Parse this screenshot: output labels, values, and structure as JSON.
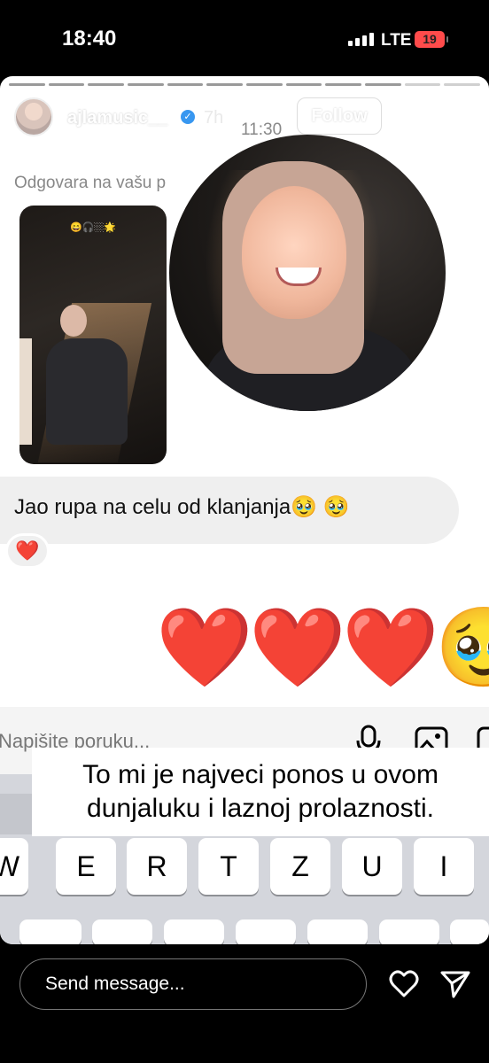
{
  "status_bar": {
    "time": "18:40",
    "network": "LTE",
    "battery": "19",
    "battery_color": "#ff4b4b"
  },
  "story": {
    "username": "ajlamusic__",
    "age": "7h",
    "follow_label": "Follow",
    "more_label": "•••",
    "close_icon": "close-icon",
    "progress_segments": 12,
    "progress_done": 10
  },
  "chat": {
    "timestamp": "11:30",
    "reply_note": "Odgovara na vašu p",
    "story_thumb_emojis": "😄🎧🏼🌟",
    "message": "Jao rupa na celu od klanjanja🥹 🥹",
    "reaction": "❤️",
    "big_emojis": [
      "❤️",
      "❤️",
      "❤️",
      "🥹"
    ]
  },
  "composer": {
    "placeholder": "Napišite poruku..."
  },
  "caption": {
    "line1": "To mi je najveci ponos u ovom",
    "line2": "dunjaluku i laznoj prolaznosti."
  },
  "keyboard": {
    "row1": [
      "W",
      "E",
      "R",
      "T",
      "Z",
      "U",
      "I"
    ]
  },
  "reply_bar": {
    "placeholder": "Send message...",
    "like_icon": "heart-icon",
    "share_icon": "send-icon"
  }
}
